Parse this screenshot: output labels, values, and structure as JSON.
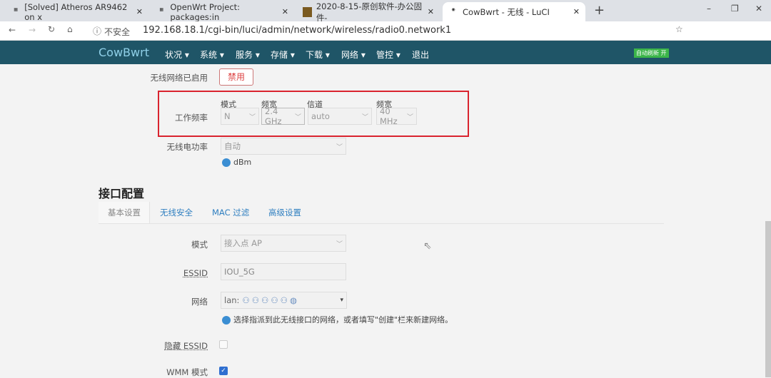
{
  "browser": {
    "tabs": [
      {
        "title": "[Solved] Atheros AR9462 on x",
        "icon": "openwrt-forum-icon"
      },
      {
        "title": "OpenWrt Project: packages:in",
        "icon": "openwrt-icon"
      },
      {
        "title": "2020-8-15-原创软件-办公固件-",
        "icon": "folder-icon"
      },
      {
        "title": "CowBwrt - 无线 - LuCI",
        "icon": "luci-icon"
      }
    ],
    "security_label": "不安全",
    "url": "192.168.18.1/cgi-bin/luci/admin/network/wireless/radio0.network1"
  },
  "nav": {
    "brand": "CowBwrt",
    "items": [
      "状况",
      "系统",
      "服务",
      "存储",
      "下载",
      "网络",
      "管控",
      "退出"
    ],
    "badge": "自动刷新 开"
  },
  "device": {
    "enabled_label": "无线网络已启用",
    "disable_button": "禁用",
    "freq_label": "工作频率",
    "col_mode": "模式",
    "col_band": "频宽",
    "col_channel": "信道",
    "col_width": "频宽",
    "mode": "N",
    "band": "2.4 GHz",
    "channel": "auto",
    "width": "40 MHz",
    "power_label": "无线电功率",
    "power": "自动",
    "power_unit": "dBm"
  },
  "iface": {
    "title": "接口配置",
    "tabs": [
      "基本设置",
      "无线安全",
      "MAC 过滤",
      "高级设置"
    ],
    "mode_label": "模式",
    "mode": "接入点 AP",
    "essid_label": "ESSID",
    "essid": "IOU_5G",
    "network_label": "网络",
    "network": "lan:",
    "network_help": "选择指派到此无线接口的网络，或者填写\"创建\"栏来新建网络。",
    "hidden_label": "隐藏 ESSID",
    "wmm_label": "WMM 模式",
    "hidden_checked": false,
    "wmm_checked": true
  },
  "colors": {
    "nav": "#1f5567",
    "highlight": "#d9232e",
    "link": "#2f7fc0"
  }
}
